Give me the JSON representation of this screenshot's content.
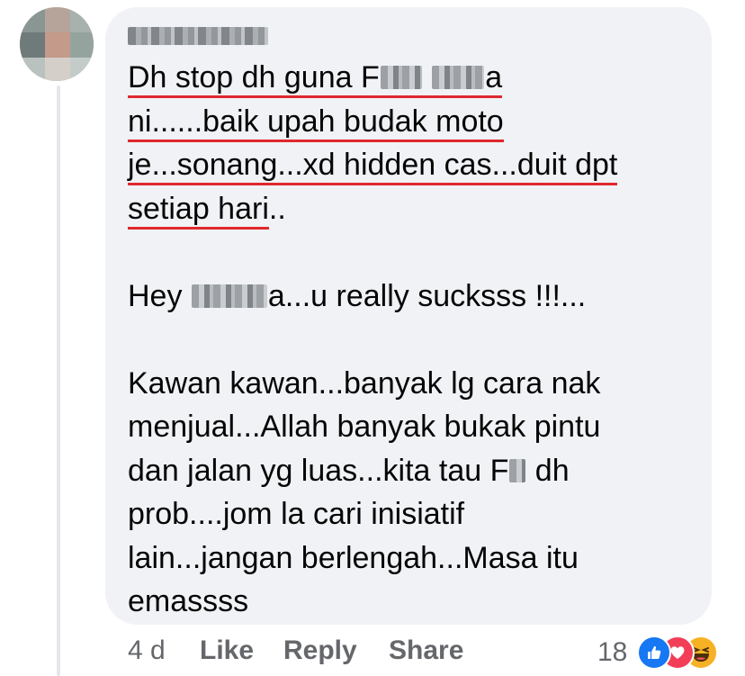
{
  "comment": {
    "lines": [
      {
        "parts": [
          "Dh stop dh guna F",
          " ",
          "a"
        ]
      },
      {
        "parts": [
          "ni......baik upah budak moto"
        ]
      },
      {
        "parts": [
          "je...sonang...xd hidden cas...duit dpt"
        ]
      },
      {
        "parts": [
          "setiap hari",
          ".."
        ]
      },
      {
        "parts": [
          "Hey ",
          "a...u really sucksss !!!..."
        ]
      },
      {
        "parts": [
          "Kawan kawan...banyak lg cara nak"
        ]
      },
      {
        "parts": [
          "menjual...Allah banyak bukak pintu"
        ]
      },
      {
        "parts": [
          "dan jalan yg luas...kita tau F",
          " dh"
        ]
      },
      {
        "parts": [
          "prob....jom la cari inisiatif"
        ]
      },
      {
        "parts": [
          "lain...jangan berlengah...Masa itu"
        ]
      },
      {
        "parts": [
          "emassss"
        ]
      }
    ]
  },
  "footer": {
    "time": "4 d",
    "like_label": "Like",
    "reply_label": "Reply",
    "share_label": "Share",
    "reaction_count": "18",
    "reactions": [
      "like-icon",
      "love-icon",
      "haha-icon"
    ]
  },
  "colors": {
    "bubble": "#f0f2f5",
    "underline": "#e0282e",
    "like": "#1877f2",
    "love": "#f33e58",
    "haha": "#f7b125"
  }
}
